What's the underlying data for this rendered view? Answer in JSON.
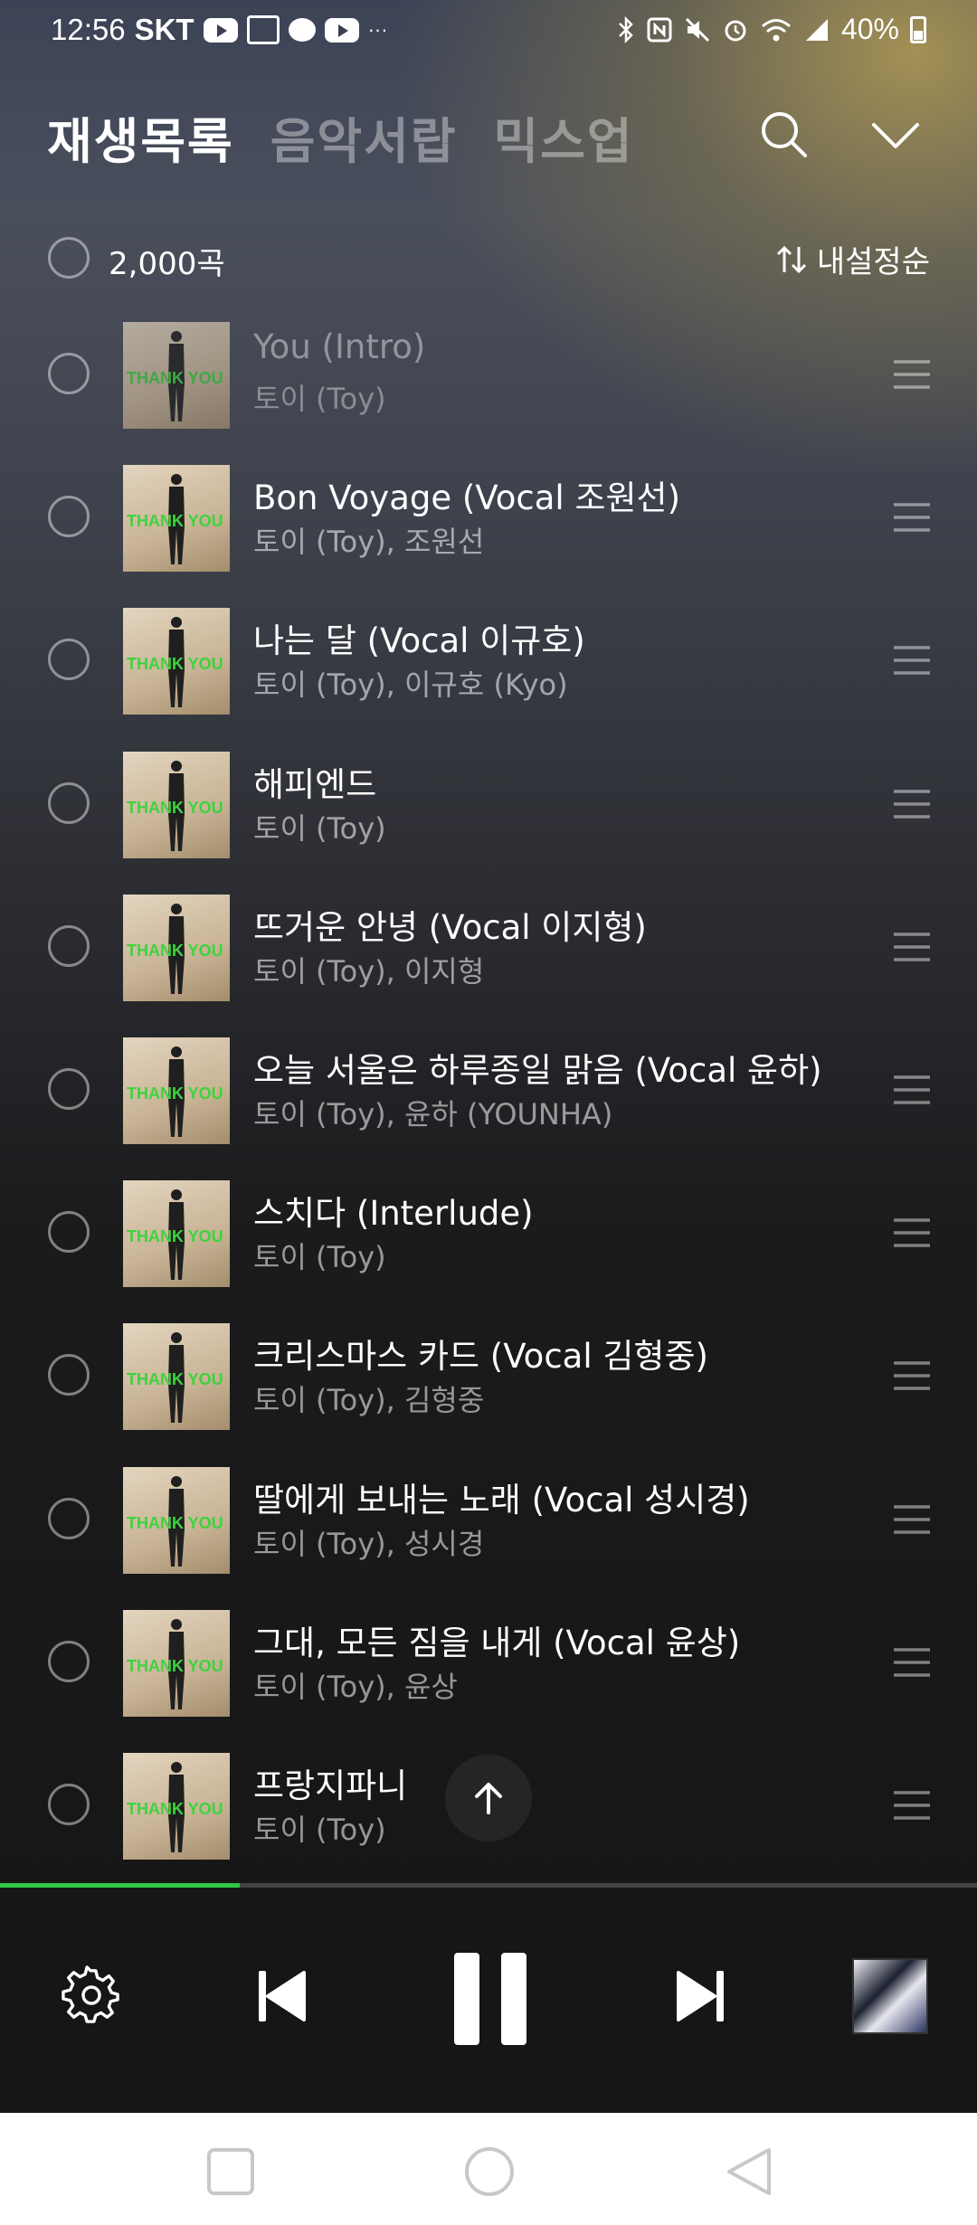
{
  "status_bar": {
    "time": "12:56",
    "carrier": "SKT",
    "battery": "40%",
    "more": "···"
  },
  "header": {
    "tabs": [
      "재생목록",
      "음악서랍",
      "믹스업"
    ],
    "active_tab": 0
  },
  "list_header": {
    "count": "2,000곡",
    "sort_label": "내설정순"
  },
  "tracks": [
    {
      "title": "You (Intro)",
      "artist": "토이 (Toy)"
    },
    {
      "title": "Bon Voyage (Vocal 조원선)",
      "artist": "토이 (Toy), 조원선"
    },
    {
      "title": "나는 달 (Vocal 이규호)",
      "artist": "토이 (Toy), 이규호 (Kyo)"
    },
    {
      "title": "해피엔드",
      "artist": "토이 (Toy)"
    },
    {
      "title": "뜨거운 안녕 (Vocal 이지형)",
      "artist": "토이 (Toy), 이지형"
    },
    {
      "title": "오늘 서울은 하루종일 맑음 (Vocal 윤하)",
      "artist": "토이 (Toy), 윤하 (YOUNHA)"
    },
    {
      "title": "스치다 (Interlude)",
      "artist": "토이 (Toy)"
    },
    {
      "title": "크리스마스 카드 (Vocal 김형중)",
      "artist": "토이 (Toy), 김형중"
    },
    {
      "title": "딸에게 보내는 노래 (Vocal 성시경)",
      "artist": "토이 (Toy), 성시경"
    },
    {
      "title": "그대, 모든 짐을 내게 (Vocal 윤상)",
      "artist": "토이 (Toy), 윤상"
    },
    {
      "title": "프랑지파니",
      "artist": "토이 (Toy)"
    }
  ],
  "album_art_text": "THANK YOU",
  "player": {
    "progress": 0.245,
    "state": "playing"
  },
  "colors": {
    "accent": "#2fc84a",
    "album_text": "#3ed33e"
  },
  "icons": {
    "search": "search-icon",
    "collapse": "chevron-down-icon",
    "sort": "sort-arrows-icon",
    "drag": "drag-handle-icon",
    "settings": "gear-icon",
    "prev": "skip-previous-icon",
    "pause": "pause-icon",
    "next": "skip-next-icon",
    "scroll_top": "arrow-up-icon"
  }
}
